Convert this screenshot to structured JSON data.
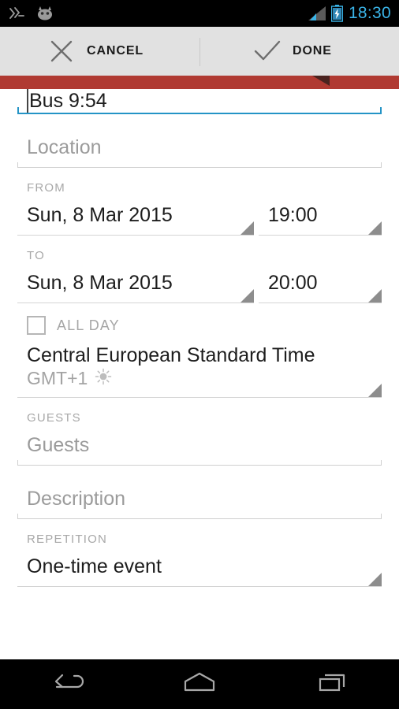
{
  "statusbar": {
    "clock": "18:30",
    "left_icons": [
      "swipe-gesture-icon",
      "cyanogenmod-icon"
    ],
    "right_icons": [
      "signal-icon",
      "battery-charging-icon"
    ],
    "accent_color": "#3ab4e8",
    "background": "#000000"
  },
  "actionbar": {
    "cancel_label": "CANCEL",
    "done_label": "DONE",
    "background": "#e1e1e1"
  },
  "accentbar": {
    "color": "#b03a32",
    "marker_color": "#4a231f"
  },
  "form": {
    "title": {
      "value": "Bus 9:54",
      "focused": true,
      "underline_color": "#2494c6"
    },
    "location": {
      "placeholder": "Location",
      "value": ""
    },
    "from": {
      "label": "FROM",
      "date": "Sun, 8 Mar 2015",
      "time": "19:00"
    },
    "to": {
      "label": "TO",
      "date": "Sun, 8 Mar 2015",
      "time": "20:00"
    },
    "all_day": {
      "label": "ALL DAY",
      "checked": false
    },
    "timezone": {
      "name": "Central European Standard Time",
      "offset": "GMT+1",
      "dst_icon": "sun-icon"
    },
    "guests": {
      "label": "GUESTS",
      "placeholder": "Guests",
      "value": ""
    },
    "description": {
      "placeholder": "Description",
      "value": ""
    },
    "repetition": {
      "label": "REPETITION",
      "value": "One-time event"
    }
  },
  "navbar": {
    "back_label": "back-icon",
    "home_label": "home-icon",
    "recents_label": "recents-icon",
    "background": "#000000"
  }
}
